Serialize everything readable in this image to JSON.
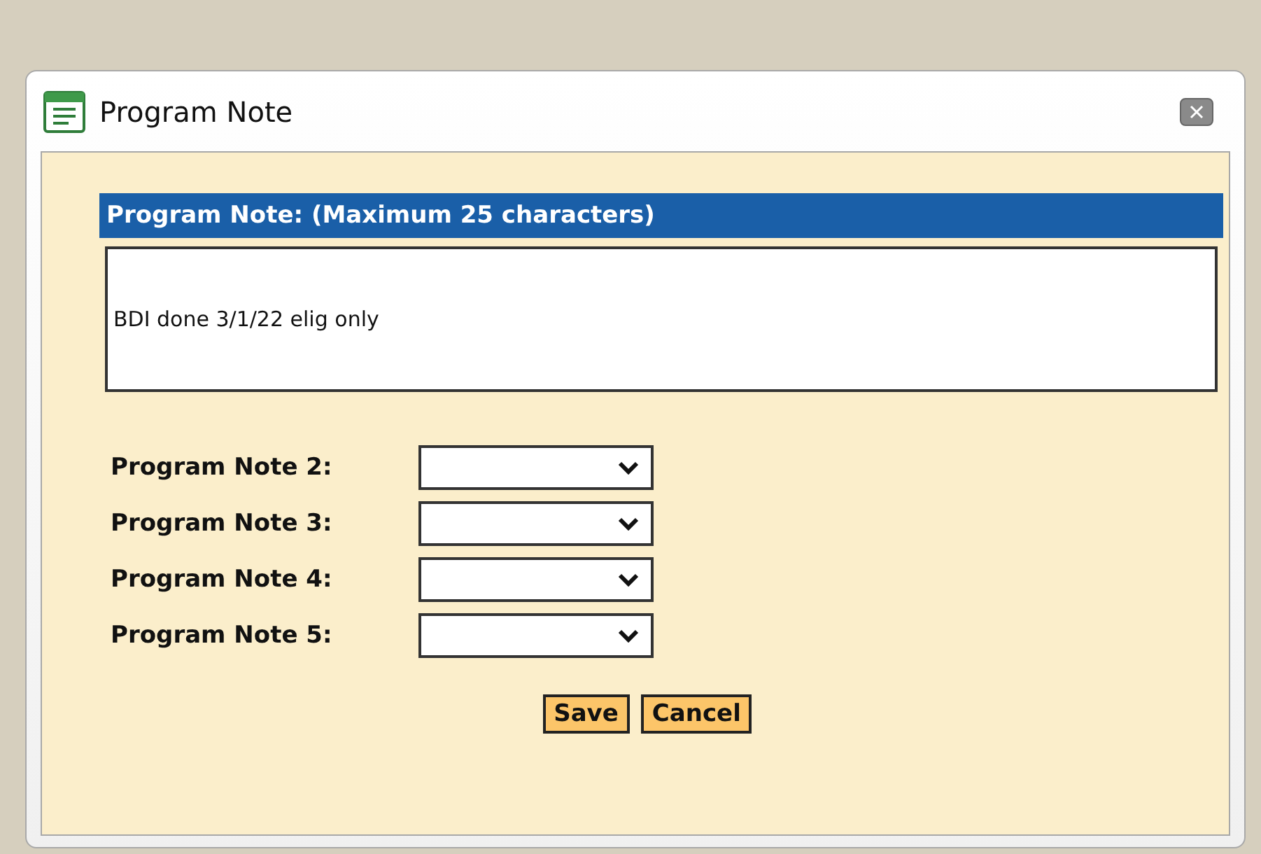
{
  "window": {
    "title": "Program Note"
  },
  "note": {
    "heading": "Program Note: (Maximum 25 characters)",
    "value": "BDI done 3/1/22 elig only"
  },
  "selects": [
    {
      "label": "Program Note 2:"
    },
    {
      "label": "Program Note 3:"
    },
    {
      "label": "Program Note 4:"
    },
    {
      "label": "Program Note 5:"
    }
  ],
  "buttons": [
    "Save",
    "Cancel"
  ]
}
